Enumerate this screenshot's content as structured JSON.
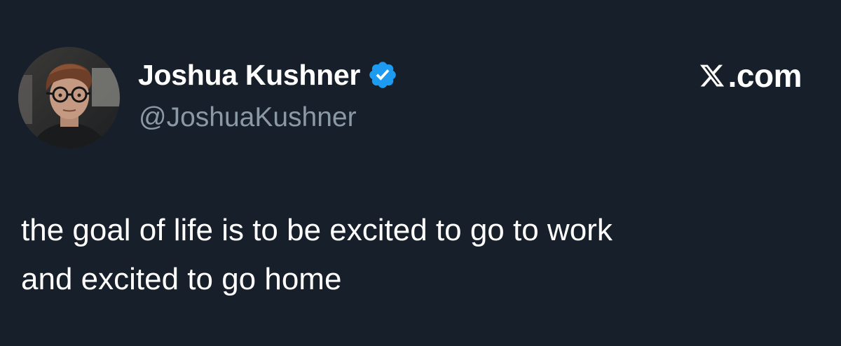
{
  "user": {
    "display_name": "Joshua Kushner",
    "handle": "@JoshuaKushner",
    "verified": true,
    "avatar_icon": "profile-photo"
  },
  "brand": {
    "logo_icon": "x-logo-icon",
    "text": ".com"
  },
  "tweet": {
    "lines": [
      "the goal of life is to be excited to go to work",
      "and excited to go home"
    ]
  },
  "colors": {
    "background": "#161f2a",
    "text_primary": "#ffffff",
    "text_secondary": "#8b98a5",
    "verified_blue": "#1d9bf0"
  }
}
